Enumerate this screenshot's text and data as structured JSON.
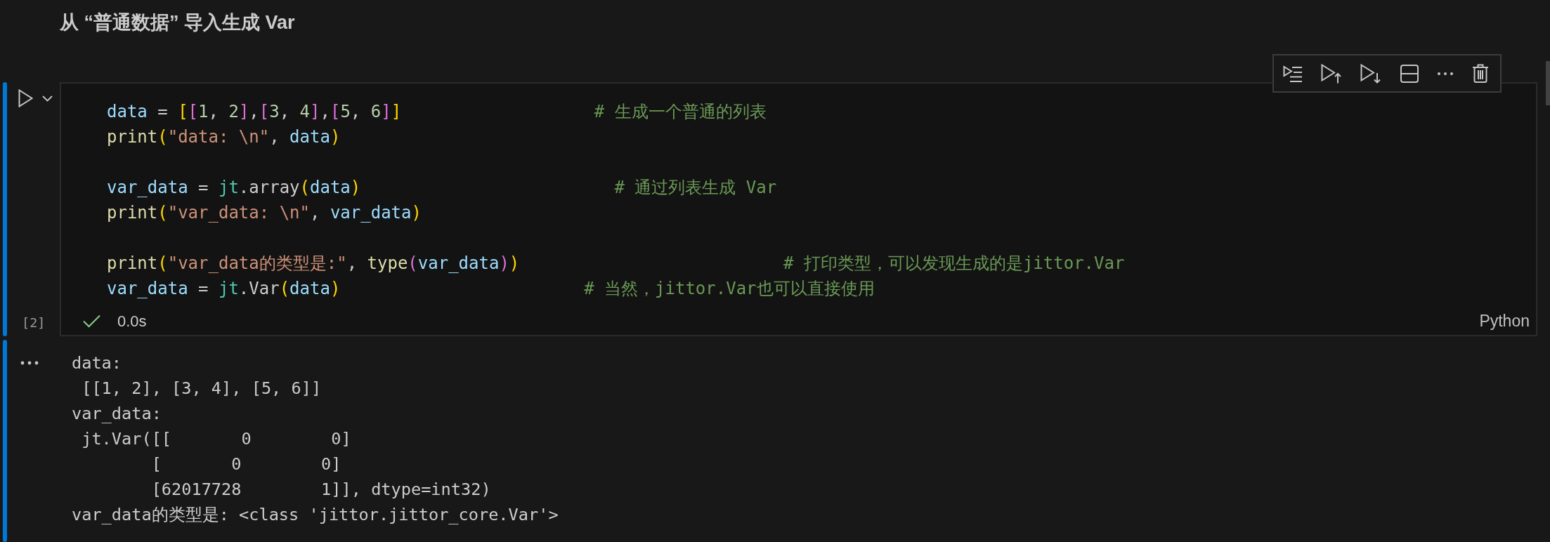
{
  "heading": "从 “普通数据” 导入生成 Var",
  "cell": {
    "selected": true,
    "execution_count": "[2]",
    "lines": [
      {
        "kind": "code",
        "tokens": [
          {
            "kind": "variable",
            "text": "data"
          },
          {
            "kind": "plain",
            "text": " = "
          },
          {
            "kind": "bracket1",
            "text": "["
          },
          {
            "kind": "bracket2",
            "text": "["
          },
          {
            "kind": "number",
            "text": "1"
          },
          {
            "kind": "plain",
            "text": ", "
          },
          {
            "kind": "number",
            "text": "2"
          },
          {
            "kind": "bracket2",
            "text": "]"
          },
          {
            "kind": "plain",
            "text": ","
          },
          {
            "kind": "bracket2",
            "text": "["
          },
          {
            "kind": "number",
            "text": "3"
          },
          {
            "kind": "plain",
            "text": ", "
          },
          {
            "kind": "number",
            "text": "4"
          },
          {
            "kind": "bracket2",
            "text": "]"
          },
          {
            "kind": "plain",
            "text": ","
          },
          {
            "kind": "bracket2",
            "text": "["
          },
          {
            "kind": "number",
            "text": "5"
          },
          {
            "kind": "plain",
            "text": ", "
          },
          {
            "kind": "number",
            "text": "6"
          },
          {
            "kind": "bracket2",
            "text": "]"
          },
          {
            "kind": "bracket1",
            "text": "]"
          }
        ],
        "comment": "# 生成一个普通的列表"
      },
      {
        "kind": "code",
        "tokens": [
          {
            "kind": "function",
            "text": "print"
          },
          {
            "kind": "bracket1",
            "text": "("
          },
          {
            "kind": "string",
            "text": "\"data: \\n\""
          },
          {
            "kind": "plain",
            "text": ", "
          },
          {
            "kind": "variable",
            "text": "data"
          },
          {
            "kind": "bracket1",
            "text": ")"
          }
        ]
      },
      {
        "kind": "blank"
      },
      {
        "kind": "code",
        "tokens": [
          {
            "kind": "variable",
            "text": "var_data"
          },
          {
            "kind": "plain",
            "text": " = "
          },
          {
            "kind": "module",
            "text": "jt"
          },
          {
            "kind": "plain",
            "text": ".array"
          },
          {
            "kind": "bracket1",
            "text": "("
          },
          {
            "kind": "variable",
            "text": "data"
          },
          {
            "kind": "bracket1",
            "text": ")"
          }
        ],
        "comment": "# 通过列表生成 Var"
      },
      {
        "kind": "code",
        "tokens": [
          {
            "kind": "function",
            "text": "print"
          },
          {
            "kind": "bracket1",
            "text": "("
          },
          {
            "kind": "string",
            "text": "\"var_data: \\n\""
          },
          {
            "kind": "plain",
            "text": ", "
          },
          {
            "kind": "variable",
            "text": "var_data"
          },
          {
            "kind": "bracket1",
            "text": ")"
          }
        ]
      },
      {
        "kind": "blank"
      },
      {
        "kind": "code",
        "tokens": [
          {
            "kind": "function",
            "text": "print"
          },
          {
            "kind": "bracket1",
            "text": "("
          },
          {
            "kind": "string",
            "text": "\"var_data的类型是:\""
          },
          {
            "kind": "plain",
            "text": ", "
          },
          {
            "kind": "function",
            "text": "type"
          },
          {
            "kind": "bracket2",
            "text": "("
          },
          {
            "kind": "variable",
            "text": "var_data"
          },
          {
            "kind": "bracket2",
            "text": ")"
          },
          {
            "kind": "bracket1",
            "text": ")"
          }
        ],
        "comment": "# 打印类型，可以发现生成的是jittor.Var"
      },
      {
        "kind": "code",
        "tokens": [
          {
            "kind": "variable",
            "text": "var_data"
          },
          {
            "kind": "plain",
            "text": " = "
          },
          {
            "kind": "module",
            "text": "jt"
          },
          {
            "kind": "plain",
            "text": ".Var"
          },
          {
            "kind": "bracket1",
            "text": "("
          },
          {
            "kind": "variable",
            "text": "data"
          },
          {
            "kind": "bracket1",
            "text": ")"
          }
        ],
        "comment": "# 当然，jittor.Var也可以直接使用"
      }
    ],
    "status": {
      "succeeded": true,
      "duration": "0.0s",
      "language": "Python"
    }
  },
  "output": {
    "lines": [
      "data:",
      " [[1, 2], [3, 4], [5, 6]]",
      "var_data:",
      " jt.Var([[       0        0]",
      "        [       0        0]",
      "        [62017728        1]], dtype=int32)",
      "var_data的类型是: <class 'jittor.jittor_core.Var'>"
    ]
  }
}
